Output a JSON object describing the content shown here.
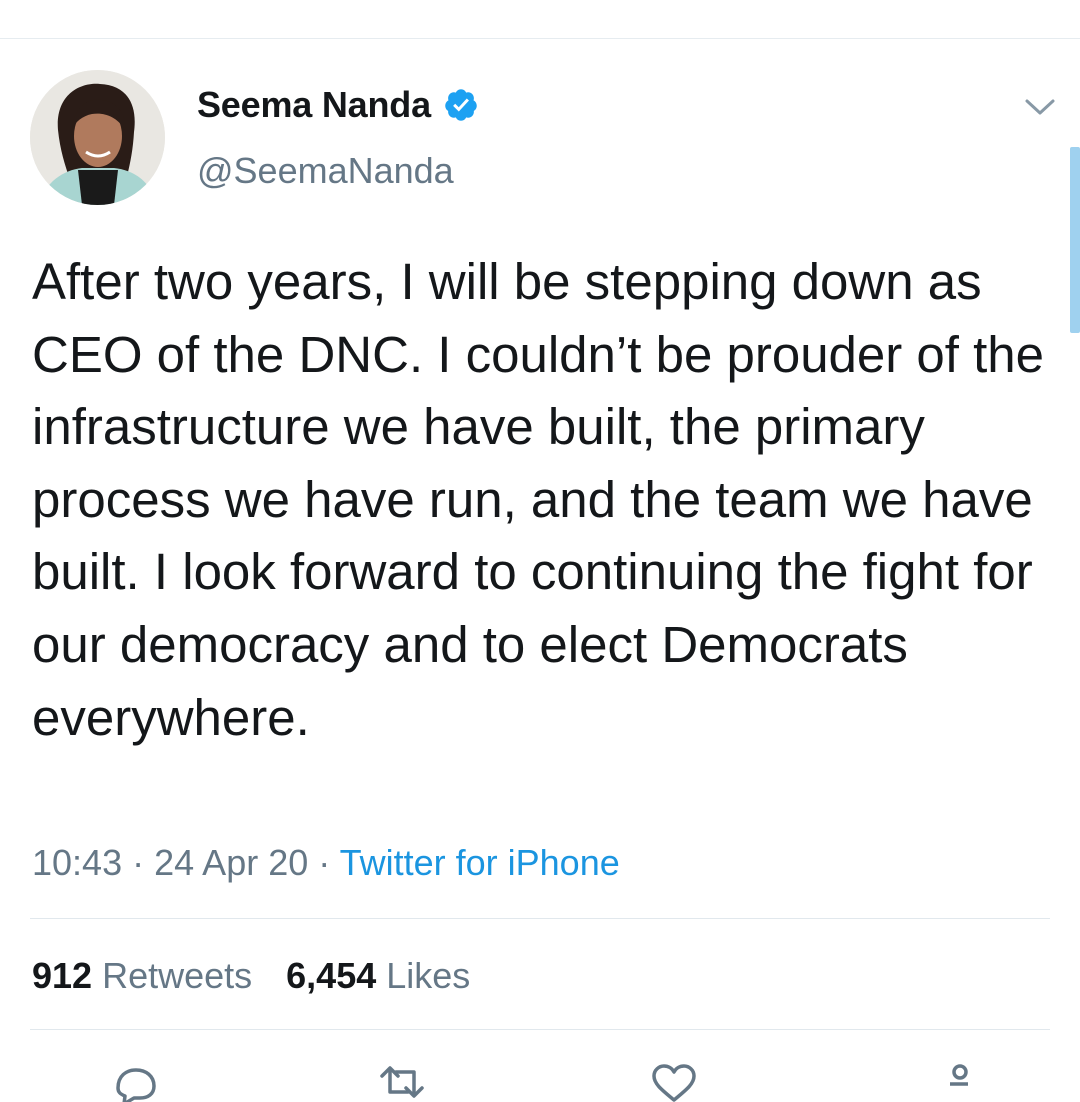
{
  "tweet": {
    "author": {
      "display_name": "Seema Nanda",
      "handle": "@SeemaNanda",
      "verified": true,
      "avatar_icon": "profile-photo"
    },
    "text": "After two years, I will be stepping down as CEO of the DNC. I couldn’t be prouder of the infrastructure we have built, the primary process we have run, and the team we have built. I look forward to continuing the fight for our democracy and to elect Democrats everywhere.",
    "time": "10:43",
    "date": "24 Apr 20",
    "separator": "·",
    "source": "Twitter for iPhone"
  },
  "stats": {
    "retweets_count": "912",
    "retweets_label": "Retweets",
    "likes_count": "6,454",
    "likes_label": "Likes"
  },
  "actions": [
    "reply-icon",
    "retweet-icon",
    "like-icon",
    "share-icon"
  ],
  "colors": {
    "text": "#14171a",
    "secondary": "#657786",
    "link": "#1b95e0",
    "verified": "#1da1f2",
    "divider": "#e1e8ed"
  }
}
